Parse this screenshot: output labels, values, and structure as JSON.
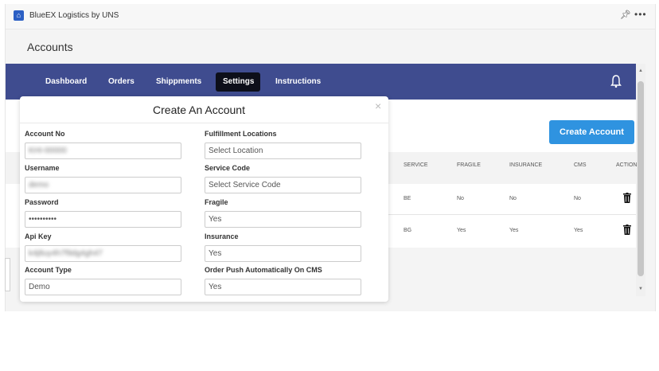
{
  "app": {
    "title": "BlueEX Logistics by UNS"
  },
  "page": {
    "title": "Accounts"
  },
  "nav": {
    "items": [
      "Dashboard",
      "Orders",
      "Shippments",
      "Settings",
      "Instructions"
    ],
    "active": "Settings"
  },
  "main": {
    "create_button": "Create Account"
  },
  "table": {
    "headers": [
      "SERVICE",
      "FRAGILE",
      "INSURANCE",
      "CMS",
      "ACTION"
    ],
    "rows": [
      [
        "BE",
        "No",
        "No",
        "No"
      ],
      [
        "BG",
        "Yes",
        "Yes",
        "Yes"
      ]
    ]
  },
  "modal": {
    "title": "Create An Account",
    "close": "×",
    "fields": {
      "account_no": {
        "label": "Account No",
        "value": "KHI-00000"
      },
      "username": {
        "label": "Username",
        "value": "demo"
      },
      "password": {
        "label": "Password",
        "value": "••••••••••"
      },
      "api_key": {
        "label": "Api Key",
        "value": "k4j8uy4h7f9dg4gh47"
      },
      "account_type": {
        "label": "Account Type",
        "value": "Demo"
      },
      "fulfillment_locations": {
        "label": "Fulfillment Locations",
        "placeholder": "Select Location"
      },
      "service_code": {
        "label": "Service Code",
        "placeholder": "Select Service Code"
      },
      "fragile": {
        "label": "Fragile",
        "value": "Yes"
      },
      "insurance": {
        "label": "Insurance",
        "value": "Yes"
      },
      "order_push": {
        "label": "Order Push Automatically On CMS",
        "value": "Yes"
      }
    }
  },
  "colors": {
    "navbar": "#3f4c8f",
    "accent": "#2f93e0",
    "active_tab": "#0d0f1a"
  },
  "icons": [
    "app-logo-icon",
    "pin-icon",
    "more-icon",
    "bell-icon",
    "trash-icon",
    "close-icon"
  ]
}
